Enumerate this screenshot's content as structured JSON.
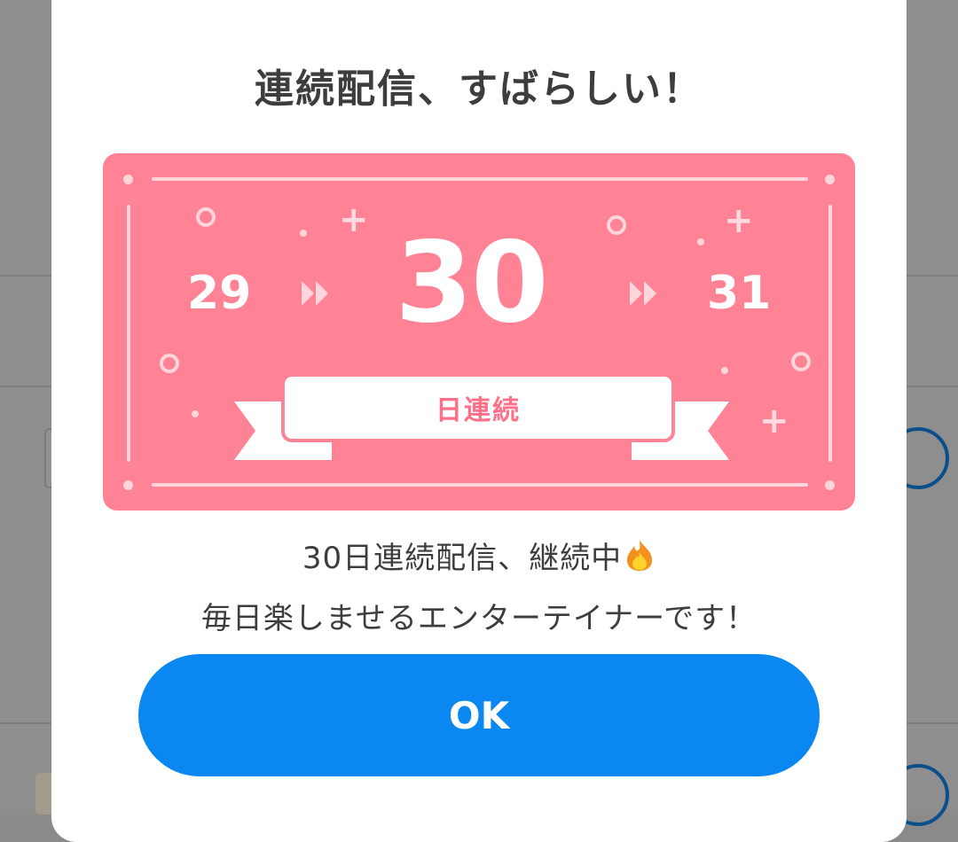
{
  "modal": {
    "title": "連続配信、すばらしい！",
    "streak": {
      "previous_day": "29",
      "current_day": "30",
      "next_day": "31",
      "ribbon_label": "日連続"
    },
    "message_line1": "30日連続配信、継続中",
    "message_line2": "毎日楽しませるエンターテイナーです！",
    "ok_label": "OK"
  },
  "colors": {
    "banner": "#ff8295",
    "button": "#0a87f0",
    "title_text": "#3d3d3d"
  },
  "icons": {
    "message_emoji": "fire-icon",
    "step_arrow": "double-chevron-right-icon"
  }
}
